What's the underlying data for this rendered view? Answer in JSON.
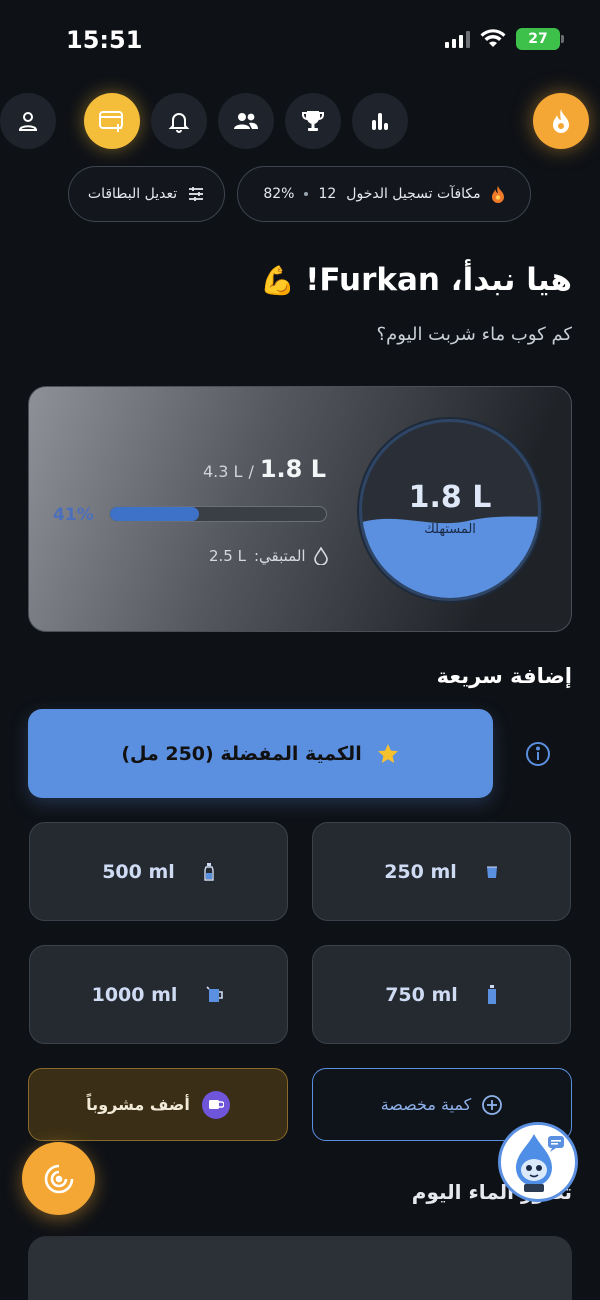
{
  "status_bar": {
    "time": "15:51",
    "battery": "27"
  },
  "chips": {
    "login_rewards": {
      "label": "مكافآت تسجيل الدخول",
      "streak": "12",
      "percent": "82%"
    },
    "edit_cards": {
      "label": "تعديل البطاقات"
    }
  },
  "greeting": {
    "text": "هيا نبدأ، Furkan!",
    "emoji": "💪"
  },
  "subtitle": "كم كوب ماء شربت اليوم؟",
  "hydration": {
    "consumed": "1.8 L",
    "goal_separator": "/",
    "goal": "4.3 L",
    "percent": "41%",
    "progress": 0.41,
    "remaining_label": "المتبقي:",
    "remaining_value": "2.5 L",
    "glass_label": "المستهلك",
    "glass_value": "1.8 L"
  },
  "quick_add": {
    "title": "إضافة سريعة",
    "favorite_label": "الكمية المفضلة (250 مل)",
    "amounts": [
      {
        "label": "250 ml",
        "icon": "glass-icon"
      },
      {
        "label": "500 ml",
        "icon": "bottle-small-icon"
      },
      {
        "label": "750 ml",
        "icon": "bottle-icon"
      },
      {
        "label": "1000 ml",
        "icon": "jug-icon"
      }
    ],
    "custom_label": "كمية مخصصة",
    "add_drink_label": "أضف مشروباً"
  },
  "history": {
    "title": "تطور الماء اليوم"
  },
  "colors": {
    "accent": "#5b8fe0",
    "gold": "#f4bd3a",
    "orange": "#f4a734",
    "background": "#0e1116"
  }
}
